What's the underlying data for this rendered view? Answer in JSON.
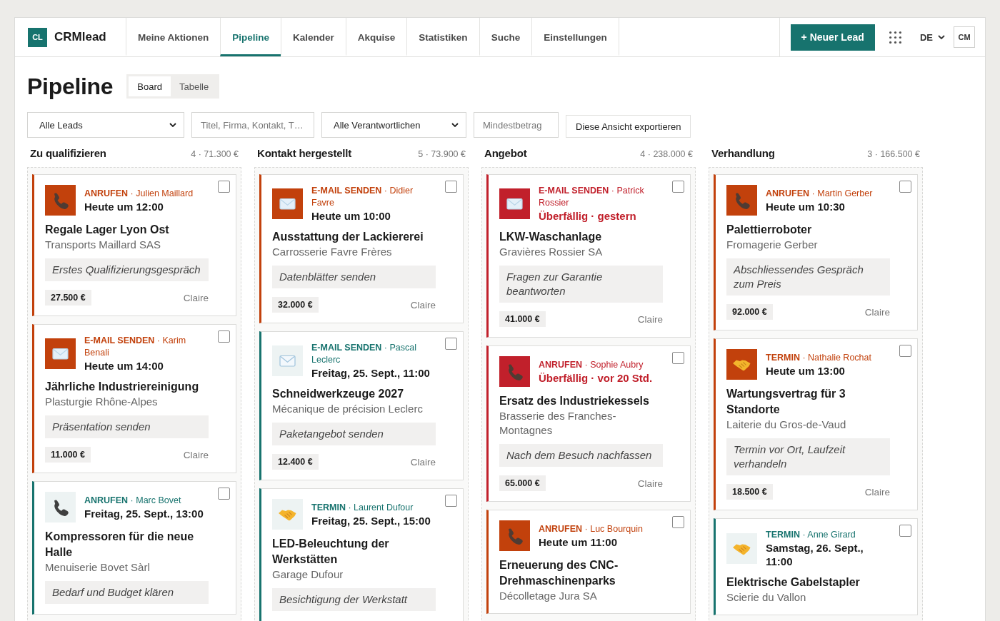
{
  "header": {
    "logo_mark": "CL",
    "brand": "CRMlead",
    "nav": [
      {
        "label": "Meine Aktionen",
        "selected": false
      },
      {
        "label": "Pipeline",
        "selected": true
      },
      {
        "label": "Kalender",
        "selected": false
      },
      {
        "label": "Akquise",
        "selected": false
      },
      {
        "label": "Statistiken",
        "selected": false
      },
      {
        "label": "Suche",
        "selected": false
      },
      {
        "label": "Einstellungen",
        "selected": false
      }
    ],
    "new_button": "+ Neuer Lead",
    "language": "DE",
    "avatar": "CM"
  },
  "page": {
    "title": "Pipeline",
    "view_tabs": [
      {
        "label": "Board",
        "selected": true
      },
      {
        "label": "Tabelle",
        "selected": false
      }
    ]
  },
  "filters": {
    "leads_select": "Alle Leads",
    "search": {
      "placeholder": "Titel, Firma, Kontakt, T…"
    },
    "owner_select": "Alle Verantwortlichen",
    "min_amount": {
      "placeholder": "Mindestbetrag"
    },
    "export_button": "Diese Ansicht exportieren"
  },
  "columns": [
    {
      "title": "Zu qualifizieren",
      "summary": "4 · 71.300 €",
      "cards": [
        {
          "kind": "call",
          "color": "#c2410c",
          "urgent": true,
          "overdue": false,
          "action": "**ANRUFEN** · Julien Maillard",
          "due": "Heute um 12:00",
          "title": "Regale Lager Lyon Ost",
          "company": "Transports Maillard SAS",
          "note": "Erstes Qualifizierungsgespräch",
          "amount": "27.500 €",
          "owner": "Claire",
          "checked": false
        },
        {
          "kind": "email",
          "color": "#c2410c",
          "urgent": true,
          "overdue": false,
          "action": "**E-MAIL SENDEN** · Karim Benali",
          "due": "Heute um 14:00",
          "title": "Jährliche Industriereinigung",
          "company": "Plasturgie Rhône-Alpes",
          "note": "Präsentation senden",
          "amount": "11.000 €",
          "owner": "Claire",
          "checked": false
        },
        {
          "kind": "call",
          "color": "#17736e",
          "urgent": false,
          "overdue": false,
          "action": "**ANRUFEN** · Marc Bovet",
          "due": "Freitag, 25. Sept., 13:00",
          "title": "Kompressoren für die neue Halle",
          "company": "Menuiserie Bovet Sàrl",
          "note": "Bedarf und Budget klären",
          "checked": false
        }
      ]
    },
    {
      "title": "Kontakt hergestellt",
      "summary": "5 · 73.900 €",
      "cards": [
        {
          "kind": "email",
          "color": "#c2410c",
          "urgent": true,
          "overdue": false,
          "action": "**E-MAIL SENDEN** · Didier Favre",
          "due": "Heute um 10:00",
          "title": "Ausstattung der Lackiererei",
          "company": "Carrosserie Favre Frères",
          "note": "Datenblätter senden",
          "amount": "32.000 €",
          "owner": "Claire",
          "checked": false
        },
        {
          "kind": "email",
          "color": "#17736e",
          "urgent": false,
          "overdue": false,
          "action": "**E-MAIL SENDEN** · Pascal Leclerc",
          "due": "Freitag, 25. Sept., 11:00",
          "title": "Schneidwerkzeuge 2027",
          "company": "Mécanique de précision Leclerc",
          "note": "Paketangebot senden",
          "amount": "12.400 €",
          "owner": "Claire",
          "checked": false
        },
        {
          "kind": "meeting",
          "color": "#17736e",
          "urgent": false,
          "overdue": false,
          "action": "**TERMIN** · Laurent Dufour",
          "due": "Freitag, 25. Sept., 15:00",
          "title": "LED-Beleuchtung der Werkstätten",
          "company": "Garage Dufour",
          "note": "Besichtigung der Werkstatt",
          "checked": false
        }
      ]
    },
    {
      "title": "Angebot",
      "summary": "4 · 238.000 €",
      "cards": [
        {
          "kind": "email",
          "color": "#c1202b",
          "urgent": true,
          "overdue": true,
          "action": "**E-MAIL SENDEN** · Patrick Rossier",
          "due": "Überfällig · gestern",
          "title": "LKW-Waschanlage",
          "company": "Gravières Rossier SA",
          "note": "Fragen zur Garantie beantworten",
          "amount": "41.000 €",
          "owner": "Claire",
          "checked": false
        },
        {
          "kind": "call",
          "color": "#c1202b",
          "urgent": true,
          "overdue": true,
          "action": "**ANRUFEN** · Sophie Aubry",
          "due": "Überfällig · vor 20 Std.",
          "title": "Ersatz des Industriekessels",
          "company": "Brasserie des Franches-Montagnes",
          "note": "Nach dem Besuch nachfassen",
          "amount": "65.000 €",
          "owner": "Claire",
          "checked": false
        },
        {
          "kind": "call",
          "color": "#c2410c",
          "urgent": true,
          "overdue": false,
          "action": "**ANRUFEN** · Luc Bourquin",
          "due": "Heute um 11:00",
          "title": "Erneuerung des CNC-Drehmaschinenparks",
          "company": "Décolletage Jura SA",
          "checked": false
        }
      ]
    },
    {
      "title": "Verhandlung",
      "summary": "3 · 166.500 €",
      "cards": [
        {
          "kind": "call",
          "color": "#c2410c",
          "urgent": true,
          "overdue": false,
          "action": "**ANRUFEN** · Martin Gerber",
          "due": "Heute um 10:30",
          "title": "Palettierroboter",
          "company": "Fromagerie Gerber",
          "note": "Abschliessendes Gespräch zum Preis",
          "amount": "92.000 €",
          "owner": "Claire",
          "checked": false
        },
        {
          "kind": "meeting",
          "color": "#c2410c",
          "urgent": true,
          "overdue": false,
          "action": "**TERMIN** · Nathalie Rochat",
          "due": "Heute um 13:00",
          "title": "Wartungsvertrag für 3 Standorte",
          "company": "Laiterie du Gros-de-Vaud",
          "note": "Termin vor Ort, Laufzeit verhandeln",
          "amount": "18.500 €",
          "owner": "Claire",
          "checked": false
        },
        {
          "kind": "meeting",
          "color": "#17736e",
          "urgent": false,
          "overdue": false,
          "action": "**TERMIN** · Anne Girard",
          "due": "Samstag, 26. Sept., 11:00",
          "title": "Elektrische Gabelstapler",
          "company": "Scierie du Vallon",
          "checked": false
        }
      ]
    }
  ]
}
